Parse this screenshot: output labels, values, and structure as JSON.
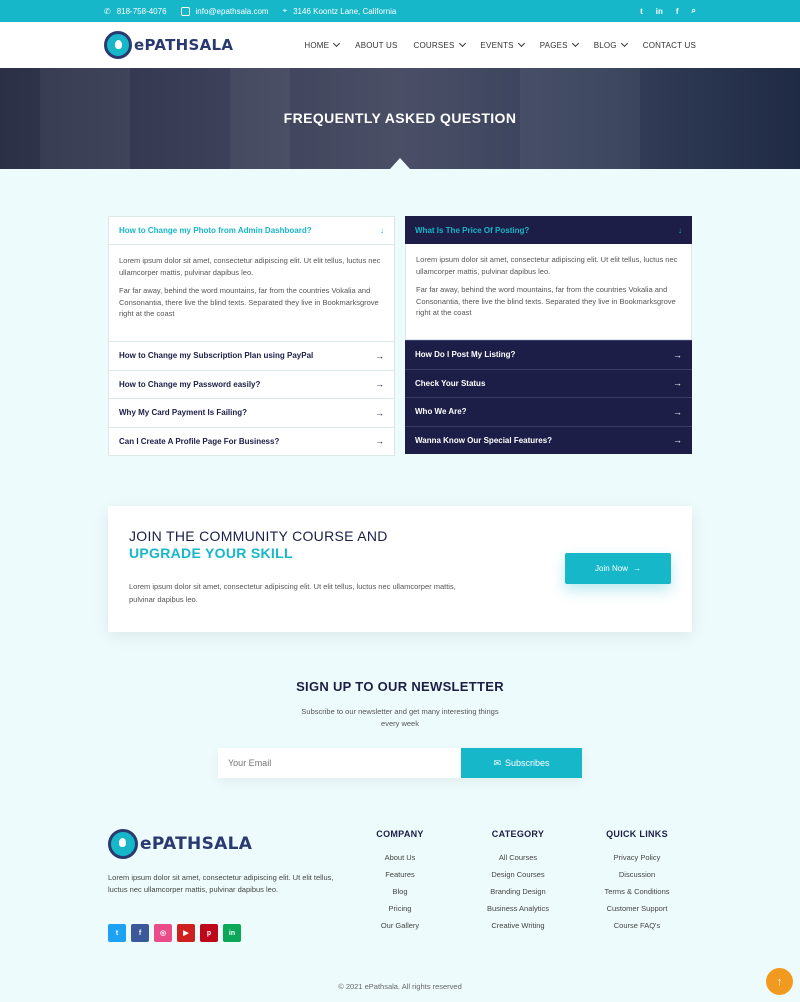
{
  "topbar": {
    "phone": "818-758-4076",
    "email": "info@epathsala.com",
    "address": "3146 Koontz Lane, California",
    "social": [
      "twitter-icon",
      "linkedin-icon",
      "facebook-icon",
      "search-icon"
    ]
  },
  "brand": {
    "name": "ePATHSALA"
  },
  "nav": {
    "home": "HOME",
    "about": "ABOUT US",
    "courses": "COURSES",
    "events": "EVENTS",
    "pages": "PAGES",
    "blog": "BLOG",
    "contact": "CONTACT US"
  },
  "hero": {
    "title": "FREQUENTLY ASKED QUESTION"
  },
  "faq": {
    "left": {
      "open_question": "How to Change my Photo from Admin Dashboard?",
      "answer_p1": "Lorem ipsum dolor sit amet, consectetur adipiscing elit. Ut elit tellus, luctus nec ullamcorper mattis, pulvinar dapibus leo.",
      "answer_p2": "Far far away, behind the word mountains, far from the countries Vokalia and Consonantia, there live the blind texts. Separated they live in Bookmarksgrove right at the coast",
      "items": [
        "How to Change my Subscription Plan using PayPal",
        "How to Change my Password easily?",
        "Why My Card Payment Is Failing?",
        "Can I Create A Profile Page For Business?"
      ]
    },
    "right": {
      "open_question": "What Is The Price Of Posting?",
      "answer_p1": "Lorem ipsum dolor sit amet, consectetur adipiscing elit. Ut elit tellus, luctus nec ullamcorper mattis, pulvinar dapibus leo.",
      "answer_p2": "Far far away, behind the word mountains, far from the countries Vokalia and Consonantia, there live the blind texts. Separated they live in Bookmarksgrove right at the coast",
      "items": [
        "How Do I Post My Listing?",
        "Check Your Status",
        "Who We Are?",
        "Wanna Know Our Special Features?"
      ]
    }
  },
  "community": {
    "title_line1": "JOIN THE COMMUNITY COURSE AND",
    "title_line2": "UPGRADE YOUR SKILL",
    "text": "Lorem ipsum dolor sit amet, consectetur adipiscing elit. Ut elit tellus, luctus nec ullamcorper mattis, pulvinar dapibus leo.",
    "button": "Join Now"
  },
  "newsletter": {
    "title": "SIGN UP TO OUR NEWSLETTER",
    "subtitle": "Subscribe to our newsletter and get many interesting things every week",
    "placeholder": "Your Email",
    "button": "Subscribes"
  },
  "footer": {
    "description": "Lorem ipsum dolor sit amet, consectetur adipiscing elit. Ut elit tellus, luctus nec ullamcorper mattis, pulvinar dapibus leo.",
    "company": {
      "title": "COMPANY",
      "links": [
        "About Us",
        "Features",
        "Blog",
        "Pricing",
        "Our Gallery"
      ]
    },
    "category": {
      "title": "CATEGORY",
      "links": [
        "All Courses",
        "Design Courses",
        "Branding Design",
        "Business Analytics",
        "Creative Writing"
      ]
    },
    "quick": {
      "title": "QUICK LINKS",
      "links": [
        "Privacy Policy",
        "Discussion",
        "Terms & Conditions",
        "Customer Support",
        "Course FAQ's"
      ]
    },
    "social": [
      {
        "icon": "twitter-icon",
        "color": "#1da1f2"
      },
      {
        "icon": "facebook-icon",
        "color": "#3b5998"
      },
      {
        "icon": "dribbble-icon",
        "color": "#ea4c89"
      },
      {
        "icon": "youtube-icon",
        "color": "#cd201f"
      },
      {
        "icon": "pinterest-icon",
        "color": "#bd081c"
      },
      {
        "icon": "linkedin-icon",
        "color": "#0aa858"
      }
    ],
    "copyright": "© 2021 ePathsala. All rights reserved"
  },
  "colors": {
    "accent": "#16b7c9",
    "navy": "#1c1e47",
    "back_to_top": "#f29a1f"
  }
}
